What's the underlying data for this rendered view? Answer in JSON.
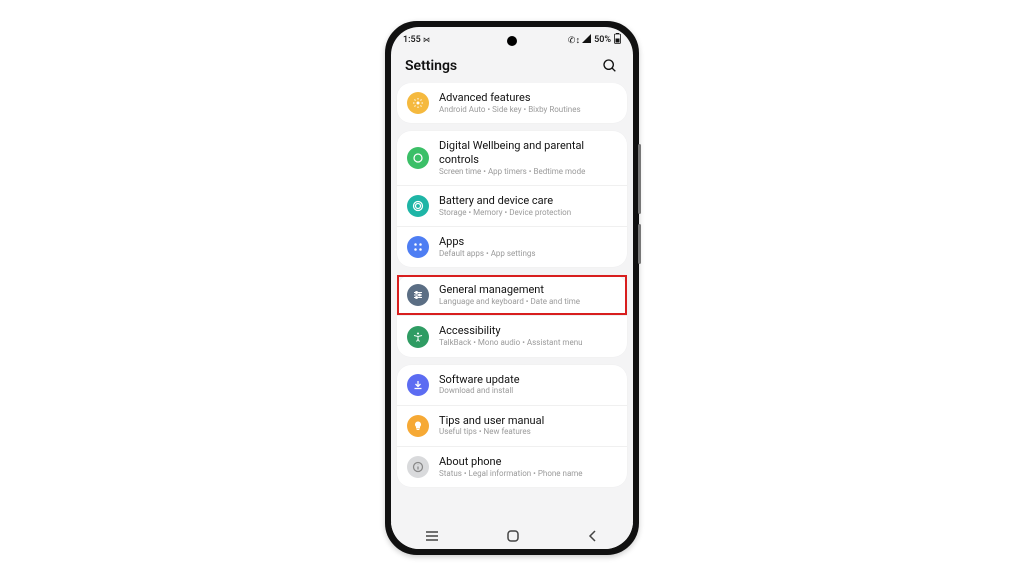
{
  "status": {
    "time": "1:55",
    "am_marker": "⋈",
    "icons": "✆ ↕",
    "battery": "50%"
  },
  "header": {
    "title": "Settings"
  },
  "colors": {
    "advanced": "#f5b93e",
    "wellbeing": "#3bbf67",
    "battery": "#1eb5a6",
    "apps": "#4e7ef3",
    "general": "#5b6e84",
    "accessibility": "#2f9c63",
    "software": "#5c6cf2",
    "tips": "#f6a935",
    "about": "#d9dadc"
  },
  "groups": [
    {
      "items": [
        {
          "id": "advanced-features",
          "icon": "adv",
          "color": "advanced",
          "title": "Advanced features",
          "sub": "Android Auto  •  Side key  •  Bixby Routines",
          "highlight": false
        }
      ]
    },
    {
      "items": [
        {
          "id": "digital-wellbeing",
          "icon": "wellbeing",
          "color": "wellbeing",
          "title": "Digital Wellbeing and parental controls",
          "sub": "Screen time  •  App timers  •  Bedtime mode",
          "highlight": false
        },
        {
          "id": "battery",
          "icon": "battery",
          "color": "battery",
          "title": "Battery and device care",
          "sub": "Storage  •  Memory  •  Device protection",
          "highlight": false
        },
        {
          "id": "apps",
          "icon": "apps",
          "color": "apps",
          "title": "Apps",
          "sub": "Default apps  •  App settings",
          "highlight": false
        }
      ]
    },
    {
      "items": [
        {
          "id": "general-management",
          "icon": "general",
          "color": "general",
          "title": "General management",
          "sub": "Language and keyboard  •  Date and time",
          "highlight": true
        },
        {
          "id": "accessibility",
          "icon": "accessibility",
          "color": "accessibility",
          "title": "Accessibility",
          "sub": "TalkBack  •  Mono audio  •  Assistant menu",
          "highlight": false
        }
      ]
    },
    {
      "items": [
        {
          "id": "software-update",
          "icon": "software",
          "color": "software",
          "title": "Software update",
          "sub": "Download and install",
          "highlight": false
        },
        {
          "id": "tips",
          "icon": "tips",
          "color": "tips",
          "title": "Tips and user manual",
          "sub": "Useful tips  •  New features",
          "highlight": false
        },
        {
          "id": "about-phone",
          "icon": "about",
          "color": "about",
          "title": "About phone",
          "sub": "Status  •  Legal information  •  Phone name",
          "highlight": false
        }
      ]
    }
  ]
}
